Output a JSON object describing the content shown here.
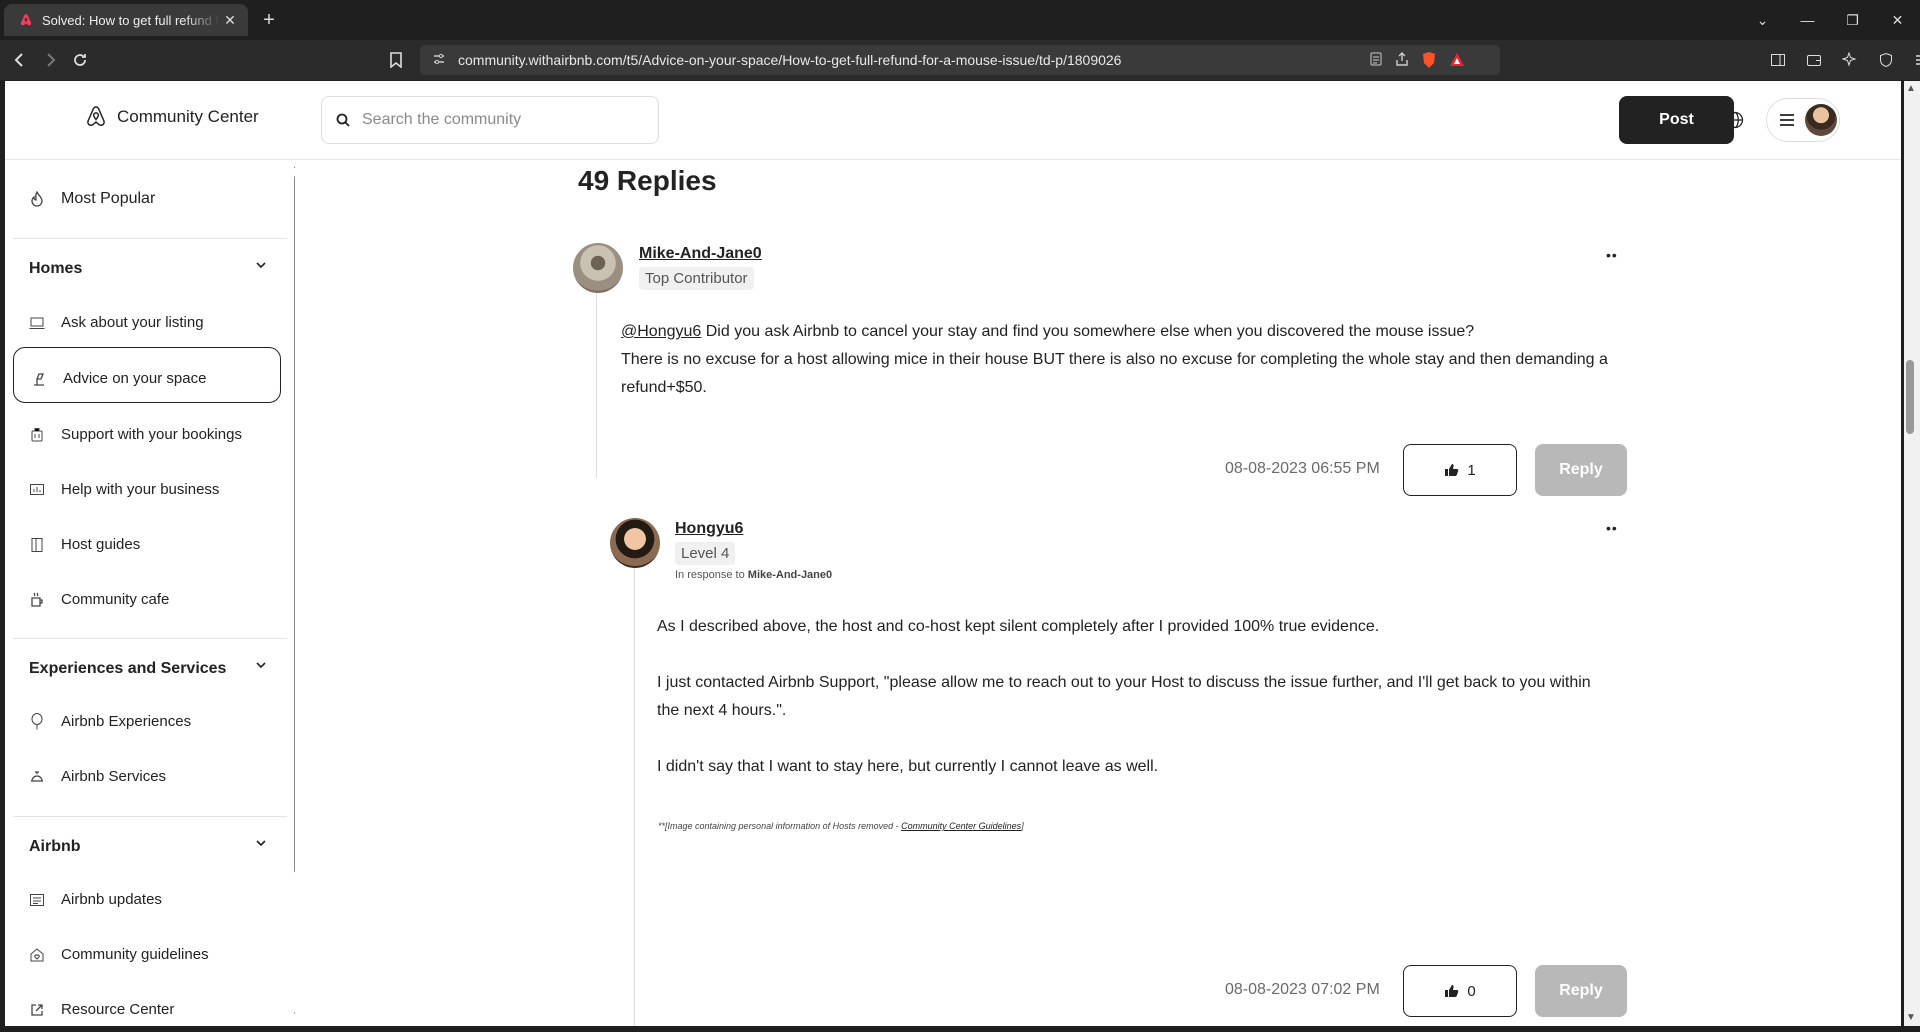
{
  "browser": {
    "tab_title": "Solved: How to get full refund fo",
    "tab_close": "✕",
    "new_tab": "+",
    "url": "community.withairbnb.com/t5/Advice-on-your-space/How-to-get-full-refund-for-a-mouse-issue/td-p/1809026"
  },
  "header": {
    "brand": "Community Center",
    "search_placeholder": "Search the community",
    "post_label": "Post"
  },
  "sidebar": {
    "most_popular": "Most Popular",
    "homes": {
      "heading": "Homes",
      "items": [
        "Ask about your listing",
        "Advice on your space",
        "Support with your bookings",
        "Help with your business",
        "Host guides",
        "Community cafe"
      ]
    },
    "experiences": {
      "heading": "Experiences and Services",
      "items": [
        "Airbnb Experiences",
        "Airbnb Services"
      ]
    },
    "airbnb": {
      "heading": "Airbnb",
      "items": [
        "Airbnb updates",
        "Community guidelines",
        "Resource Center"
      ]
    }
  },
  "main": {
    "replies_title": "49 Replies",
    "post1": {
      "author": "Mike-And-Jane0",
      "rank": "Top Contributor",
      "mention": "@Hongyu6",
      "line1": " Did you ask Airbnb to cancel your stay and find you somewhere else when you discovered the mouse issue?",
      "line2": "There is no excuse for a host allowing mice in their house BUT there is also no excuse for completing the whole stay and then demanding a",
      "line3": "refund+$50.",
      "timestamp": "08-08-2023 06:55 PM",
      "likes": "1",
      "reply_label": "Reply"
    },
    "post2": {
      "author": "Hongyu6",
      "rank": "Level 4",
      "in_response_prefix": "In response to ",
      "in_response_to": "Mike-And-Jane0",
      "para1": "As I described above, the host and co-host kept silent completely after I provided 100% true evidence.",
      "para2a": "I just contacted Airbnb Support, \"please allow me to reach out to your Host to discuss the issue further, and I'll get back to you within",
      "para2b": "the next 4 hours.\".",
      "para3": "I didn't say that I want to stay here, but currently I cannot leave as well.",
      "note_prefix": "**[Image containing personal information of Hosts removed - ",
      "note_link": "Community Center Guidelines",
      "note_suffix": "]",
      "timestamp": "08-08-2023 07:02 PM",
      "likes": "0",
      "reply_label": "Reply"
    }
  },
  "colors": {
    "brand": "#ff385c",
    "button_dark": "#222222",
    "reply_disabled": "#b8b8b8"
  }
}
